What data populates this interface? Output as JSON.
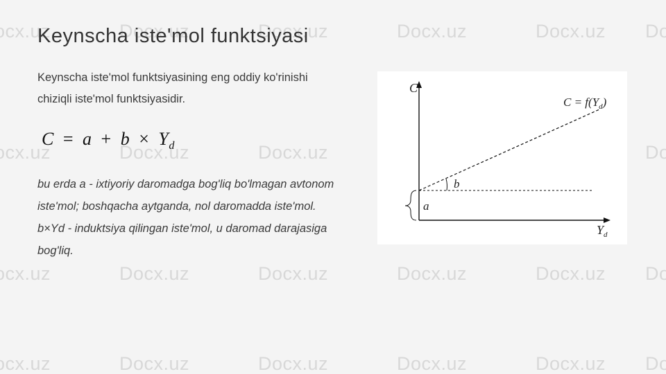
{
  "watermark": "Docx.uz",
  "title": "Keynscha iste'mol funktsiyasi",
  "intro": "Keynscha iste'mol funktsiyasining eng oddiy ko'rinishi chiziqli iste'mol funktsiyasidir.",
  "formula": {
    "lhs": "C",
    "eq": "=",
    "a": "a",
    "plus": "+",
    "b": "b",
    "times": "×",
    "Y": "Y",
    "sub": "d"
  },
  "desc": "bu erda a - ixtiyoriy daromadga bog'liq bo'lmagan avtonom iste'mol; boshqacha aytganda, nol daromadda iste'mol. b×Yd - induktsiya qilingan iste'mol, u daromad darajasiga bog'liq.",
  "chart_data": {
    "type": "line",
    "title": "",
    "xlabel": "Yd",
    "ylabel": "C",
    "legend": "C = f(Yd)",
    "a_label": "a",
    "b_label": "b",
    "intercept": 0.22,
    "slope": 0.38,
    "xlim": [
      0,
      1
    ],
    "ylim": [
      0,
      1
    ],
    "series": [
      {
        "name": "C = f(Yd)",
        "points": [
          [
            0,
            0.22
          ],
          [
            1,
            0.6
          ]
        ]
      }
    ],
    "annotations": {
      "a": "vertical offset (autonomous consumption) from origin to line intercept",
      "b": "angle / slope marker near intercept"
    }
  }
}
